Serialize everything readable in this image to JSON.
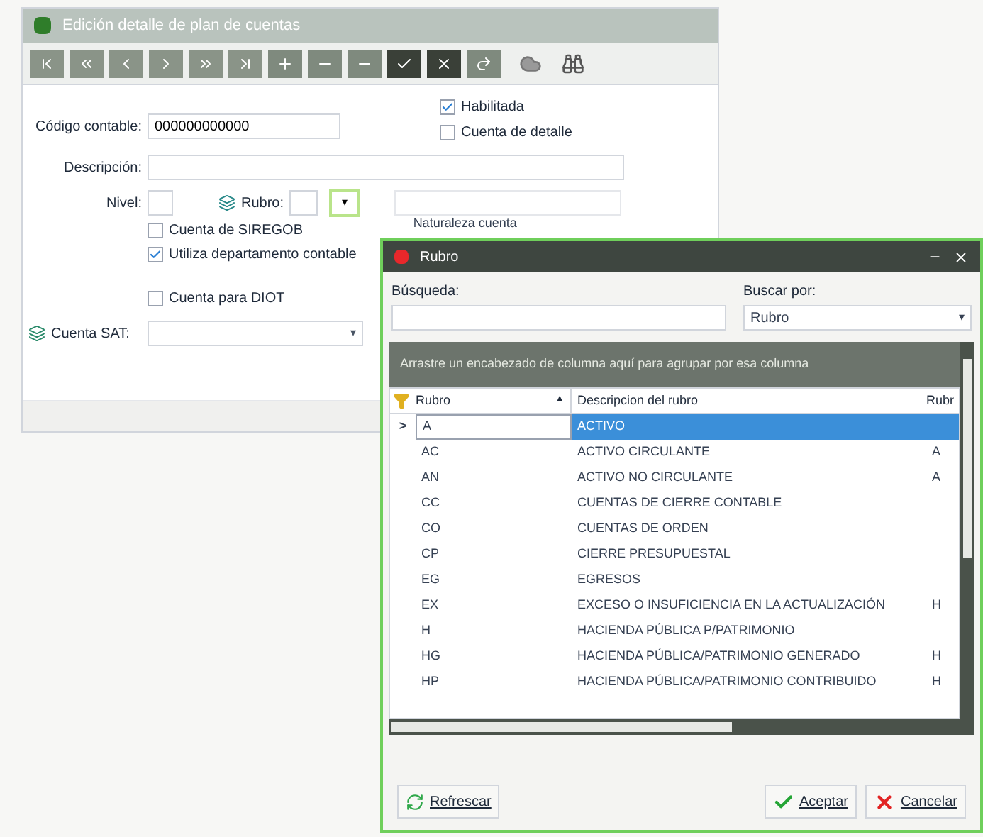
{
  "main_window": {
    "title": "Edición detalle de plan de cuentas",
    "codigo": {
      "label": "Código contable:",
      "value": "000000000000"
    },
    "checks_top": [
      {
        "label": "Habilitada",
        "checked": true
      },
      {
        "label": "Cuenta de detalle",
        "checked": false
      }
    ],
    "descripcion": {
      "label": "Descripción:"
    },
    "nivel": {
      "label": "Nivel:"
    },
    "rubro": {
      "label": "Rubro:",
      "button": "▾"
    },
    "naturaleza": {
      "label": "Naturaleza cuenta"
    },
    "checks": [
      {
        "label": "Cuenta de SIREGOB",
        "checked": false
      },
      {
        "label": "Utiliza departamento contable",
        "checked": true
      }
    ],
    "diot": {
      "label": "Cuenta para DIOT",
      "checked": false
    },
    "sat": {
      "label": "Cuenta SAT:",
      "arrow": "▾"
    }
  },
  "dialog": {
    "title": "Rubro",
    "busqueda": {
      "label": "Búsqueda:"
    },
    "buscar_por": {
      "label": "Buscar por:",
      "value": "Rubro",
      "arrow": "▾"
    },
    "group_hint": "Arrastre un encabezado de columna aquí para agrupar por esa columna",
    "columns": [
      {
        "label": "Rubro",
        "sort": "▲"
      },
      {
        "label": "Descripcion del rubro"
      },
      {
        "label": "Rubr"
      }
    ],
    "rows": [
      {
        "indicator": ">",
        "code": "A",
        "desc": "ACTIVO",
        "selected": true
      },
      {
        "code": "AC",
        "desc": "ACTIVO CIRCULANTE",
        "parent": "A",
        "selected": false
      },
      {
        "code": "AN",
        "desc": "ACTIVO NO CIRCULANTE",
        "parent": "A",
        "selected": false
      },
      {
        "code": "CC",
        "desc": "CUENTAS DE CIERRE CONTABLE",
        "selected": false
      },
      {
        "code": "CO",
        "desc": "CUENTAS DE ORDEN",
        "selected": false
      },
      {
        "code": "CP",
        "desc": "CIERRE PRESUPUESTAL",
        "selected": false
      },
      {
        "code": "EG",
        "desc": "EGRESOS",
        "selected": false
      },
      {
        "code": "EX",
        "desc": "EXCESO O INSUFICIENCIA EN LA ACTUALIZACIÓN",
        "parent": "H",
        "selected": false
      },
      {
        "code": "H",
        "desc": "HACIENDA PÚBLICA P/PATRIMONIO",
        "selected": false
      },
      {
        "code": "HG",
        "desc": "HACIENDA PÚBLICA/PATRIMONIO GENERADO",
        "parent": "H",
        "selected": false
      },
      {
        "code": "HP",
        "desc": "HACIENDA PÚBLICA/PATRIMONIO CONTRIBUIDO",
        "parent": "H",
        "selected": false
      }
    ],
    "buttons": [
      {
        "kind": "refresh",
        "label": "Refrescar"
      },
      {
        "kind": "accept",
        "label": "Aceptar"
      },
      {
        "kind": "cancel",
        "label": "Cancelar"
      }
    ]
  }
}
